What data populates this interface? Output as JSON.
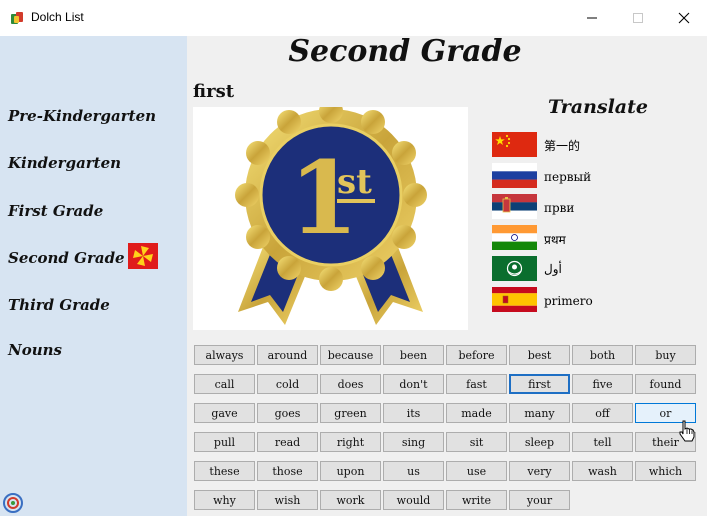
{
  "window": {
    "title": "Dolch List"
  },
  "sidebar": {
    "items": [
      {
        "label": "Pre-Kindergarten"
      },
      {
        "label": "Kindergarten"
      },
      {
        "label": "First Grade"
      },
      {
        "label": "Second Grade"
      },
      {
        "label": "Third Grade"
      },
      {
        "label": "Nouns"
      }
    ]
  },
  "main": {
    "title": "Second Grade",
    "word": "first",
    "translate_title": "Translate",
    "translations": [
      {
        "flag": "china-flag-icon",
        "text": "第一的"
      },
      {
        "flag": "russia-flag-icon",
        "text": "первый"
      },
      {
        "flag": "serbia-flag-icon",
        "text": "први"
      },
      {
        "flag": "india-flag-icon",
        "text": "प्रथम"
      },
      {
        "flag": "arab-league-flag-icon",
        "text": "أول"
      },
      {
        "flag": "spain-flag-icon",
        "text": "primero"
      }
    ],
    "selected_word": "first",
    "hovered_word": "or"
  },
  "words": [
    "always",
    "around",
    "because",
    "been",
    "before",
    "best",
    "both",
    "buy",
    "call",
    "cold",
    "does",
    "don't",
    "fast",
    "first",
    "five",
    "found",
    "gave",
    "goes",
    "green",
    "its",
    "made",
    "many",
    "off",
    "or",
    "pull",
    "read",
    "right",
    "sing",
    "sit",
    "sleep",
    "tell",
    "their",
    "these",
    "those",
    "upon",
    "us",
    "use",
    "very",
    "wash",
    "which",
    "why",
    "wish",
    "work",
    "would",
    "write",
    "your"
  ],
  "colors": {
    "sidebar_bg": "#d7e4f2",
    "main_bg": "#f0f0f0",
    "selected_border": "#1e6fc4",
    "ribbon_gold": "#c9a43a",
    "ribbon_navy": "#1c2f7a"
  }
}
